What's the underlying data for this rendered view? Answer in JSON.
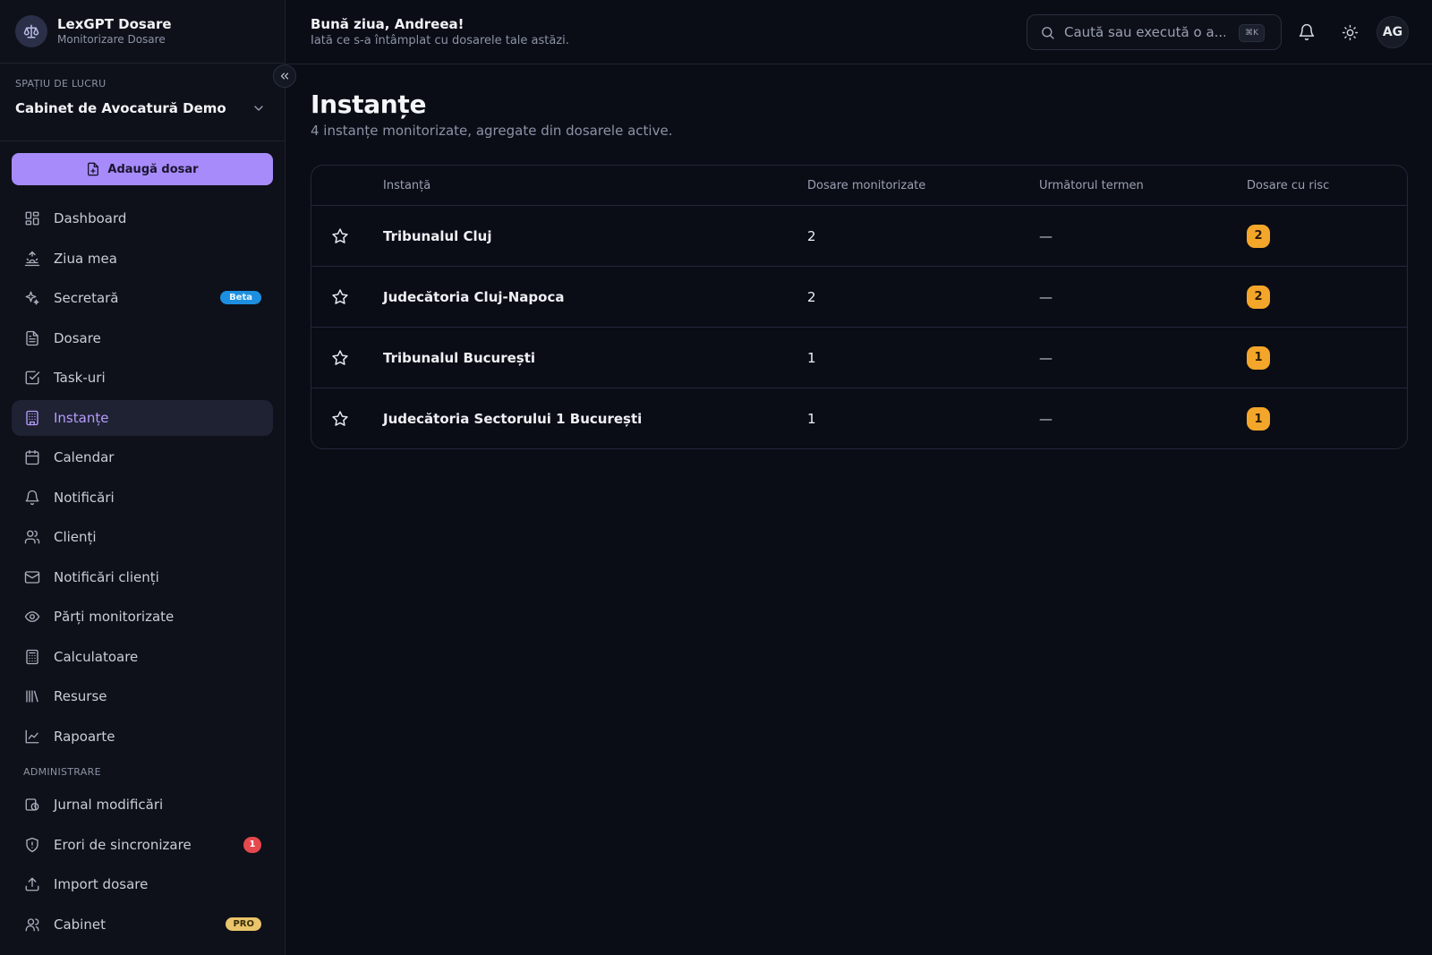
{
  "brand": {
    "title": "LexGPT Dosare",
    "subtitle": "Monitorizare Dosare"
  },
  "workspace": {
    "label": "SPAȚIU DE LUCRU",
    "name": "Cabinet de Avocatură Demo"
  },
  "add_button": {
    "label": "Adaugă dosar"
  },
  "nav": {
    "items": [
      {
        "label": "Dashboard",
        "icon": "grid-icon"
      },
      {
        "label": "Ziua mea",
        "icon": "sunrise-icon"
      },
      {
        "label": "Secretară",
        "icon": "sparkles-icon",
        "badge": "Beta"
      },
      {
        "label": "Dosare",
        "icon": "file-text-icon"
      },
      {
        "label": "Task-uri",
        "icon": "check-square-icon"
      },
      {
        "label": "Instanțe",
        "icon": "building-icon",
        "active": true
      },
      {
        "label": "Calendar",
        "icon": "calendar-icon"
      },
      {
        "label": "Notificări",
        "icon": "bell-icon"
      },
      {
        "label": "Clienți",
        "icon": "users-icon"
      },
      {
        "label": "Notificări clienți",
        "icon": "mail-icon"
      },
      {
        "label": "Părți monitorizate",
        "icon": "eye-icon"
      },
      {
        "label": "Calculatoare",
        "icon": "calculator-icon"
      },
      {
        "label": "Resurse",
        "icon": "library-icon"
      },
      {
        "label": "Rapoarte",
        "icon": "line-chart-icon"
      }
    ],
    "admin_label": "ADMINISTRARE",
    "admin_items": [
      {
        "label": "Jurnal modificări",
        "icon": "history-icon"
      },
      {
        "label": "Erori de sincronizare",
        "icon": "shield-alert-icon",
        "count": "1"
      },
      {
        "label": "Import dosare",
        "icon": "upload-icon"
      },
      {
        "label": "Cabinet",
        "icon": "user-icon",
        "badge": "PRO"
      }
    ]
  },
  "header": {
    "greeting": "Bună ziua, Andreea!",
    "subtitle": "Iată ce s-a întâmplat cu dosarele tale astăzi.",
    "search_placeholder": "Caută sau execută o a...",
    "search_shortcut": "⌘K",
    "avatar_initials": "AG"
  },
  "page": {
    "title": "Instanțe",
    "subtitle": "4 instanțe monitorizate, agregate din dosarele active."
  },
  "table": {
    "columns": [
      "Instanță",
      "Dosare monitorizate",
      "Următorul termen",
      "Dosare cu risc"
    ],
    "rows": [
      {
        "name": "Tribunalul Cluj",
        "monitored": "2",
        "next": "—",
        "risk": "2"
      },
      {
        "name": "Judecătoria Cluj-Napoca",
        "monitored": "2",
        "next": "—",
        "risk": "2"
      },
      {
        "name": "Tribunalul București",
        "monitored": "1",
        "next": "—",
        "risk": "1"
      },
      {
        "name": "Judecătoria Sectorului 1 București",
        "monitored": "1",
        "next": "—",
        "risk": "1"
      }
    ]
  },
  "colors": {
    "accent": "#a78bfa",
    "active_text": "#b79cfb",
    "risk": "#f4a62a",
    "beta": "#1d8fe0",
    "error": "#e5484d",
    "pro": "#e9c46a",
    "background": "#0a0d16"
  }
}
